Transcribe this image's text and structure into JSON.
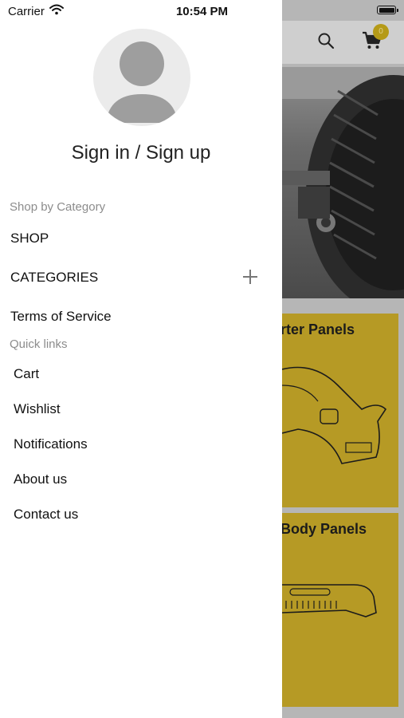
{
  "status_bar": {
    "carrier": "Carrier",
    "time": "10:54 PM"
  },
  "drawer": {
    "sign_in": "Sign in / Sign up",
    "shop_section_label": "Shop by Category",
    "shop_label": "SHOP",
    "categories_label": "CATEGORIES",
    "terms_label": "Terms of Service",
    "quick_links_label": "Quick links",
    "quick_links": [
      "Cart",
      "Wishlist",
      "Notifications",
      "About us",
      "Contact us"
    ]
  },
  "background_app": {
    "cart_count": "0",
    "card_titles": [
      "rter Panels",
      "Body Panels"
    ],
    "accent_color": "#b69a25"
  }
}
